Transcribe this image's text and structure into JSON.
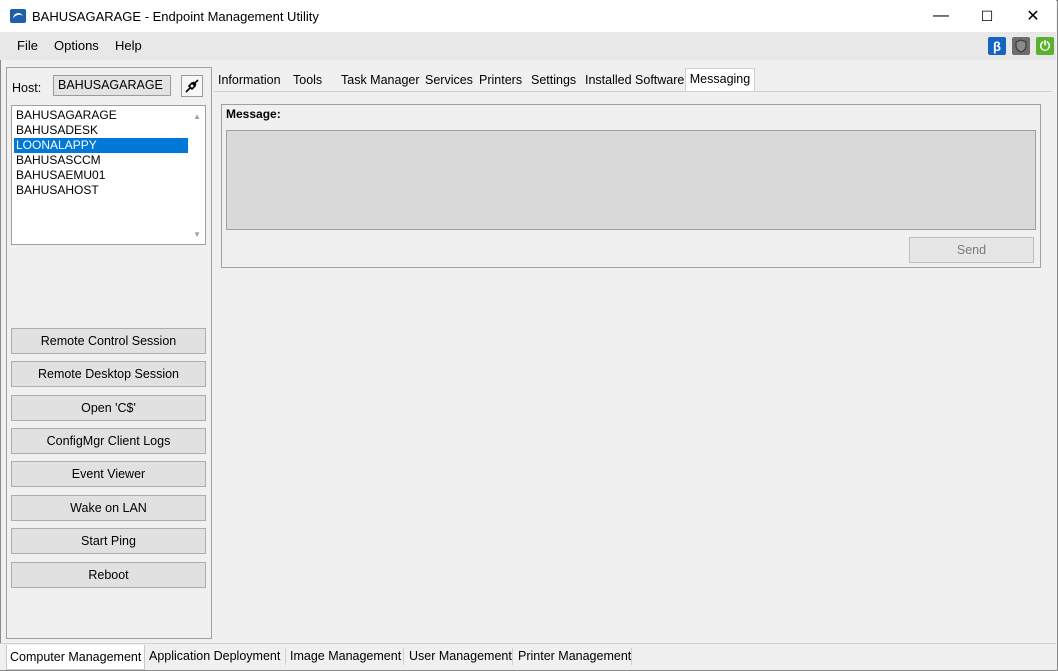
{
  "window": {
    "title": "BAHUSAGARAGE - Endpoint Management Utility",
    "controls": {
      "minimize": "—",
      "maximize": "☐",
      "close": "✕"
    }
  },
  "menu": {
    "items": [
      "File",
      "Options",
      "Help"
    ]
  },
  "toolbar_icons": [
    {
      "name": "beta-icon",
      "glyph": "β",
      "color": "#1565c0"
    },
    {
      "name": "shield-icon",
      "glyph": "",
      "color": "#6d6d6d"
    },
    {
      "name": "power-icon",
      "glyph": "⏻",
      "color": "#5cb030"
    }
  ],
  "host": {
    "label": "Host:",
    "value": "BAHUSAGARAGE",
    "list": [
      "BAHUSAGARAGE",
      "BAHUSADESK",
      "LOONALAPPY",
      "BAHUSASCCM",
      "BAHUSAEMU01",
      "BAHUSAHOST"
    ],
    "selected": "LOONALAPPY"
  },
  "actions": [
    "Remote Control Session",
    "Remote Desktop Session",
    "Open 'C$'",
    "ConfigMgr Client Logs",
    "Event Viewer",
    "Wake on LAN",
    "Start Ping",
    "Reboot"
  ],
  "tabs": {
    "items": [
      "Information",
      "Tools",
      "Task Manager",
      "Services",
      "Printers",
      "Settings",
      "Installed Software",
      "Messaging"
    ],
    "active": "Messaging"
  },
  "messaging": {
    "label": "Message:",
    "value": "",
    "send_label": "Send"
  },
  "bottom_tabs": {
    "items": [
      "Computer Management",
      "Application Deployment",
      "Image Management",
      "User Management",
      "Printer Management"
    ],
    "active": "Computer Management"
  },
  "colors": {
    "selection": "#0078d7",
    "beta": "#1565c0",
    "power": "#5cb030"
  }
}
